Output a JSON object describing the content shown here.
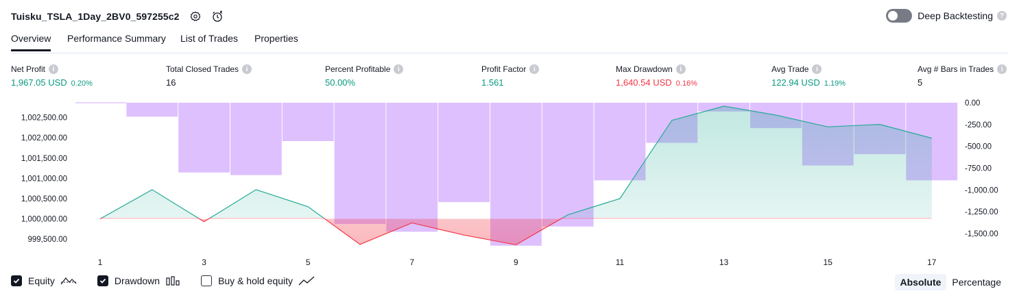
{
  "header": {
    "title": "Tuisku_TSLA_1Day_2BV0_597255c2"
  },
  "deep_backtesting": {
    "label": "Deep Backtesting",
    "enabled": false,
    "help": "?"
  },
  "tabs": [
    {
      "label": "Overview",
      "active": true
    },
    {
      "label": "Performance Summary",
      "active": false
    },
    {
      "label": "List of Trades",
      "active": false
    },
    {
      "label": "Properties",
      "active": false
    }
  ],
  "metrics": [
    {
      "label": "Net Profit",
      "value": "1,967.05 USD",
      "pct": "0.20%",
      "color": "#089981"
    },
    {
      "label": "Total Closed Trades",
      "value": "16",
      "pct": "",
      "color": "#131722"
    },
    {
      "label": "Percent Profitable",
      "value": "50.00%",
      "pct": "",
      "color": "#089981"
    },
    {
      "label": "Profit Factor",
      "value": "1.561",
      "pct": "",
      "color": "#089981"
    },
    {
      "label": "Max Drawdown",
      "value": "1,640.54 USD",
      "pct": "0.16%",
      "color": "#f23645"
    },
    {
      "label": "Avg Trade",
      "value": "122.94 USD",
      "pct": "1.19%",
      "color": "#089981"
    },
    {
      "label": "Avg # Bars in Trades",
      "value": "5",
      "pct": "",
      "color": "#131722"
    }
  ],
  "chart_data": {
    "type": "line",
    "x": [
      1,
      2,
      3,
      4,
      5,
      6,
      7,
      8,
      9,
      10,
      11,
      12,
      13,
      14,
      15,
      16,
      17
    ],
    "x_tick_labels": [
      "1",
      "3",
      "5",
      "7",
      "9",
      "11",
      "13",
      "15",
      "17"
    ],
    "left_axis": {
      "tick_labels": [
        "1,002,500.00",
        "1,002,000.00",
        "1,001,500.00",
        "1,001,000.00",
        "1,000,500.00",
        "1,000,000.00",
        "999,500.00"
      ],
      "ylim": [
        999350,
        1002780
      ]
    },
    "right_axis": {
      "tick_labels": [
        "0.00",
        "-250.00",
        "-500.00",
        "-750.00",
        "-1,000.00",
        "-1,250.00",
        "-1,500.00"
      ],
      "ylim": [
        -1650,
        0
      ]
    },
    "series": [
      {
        "name": "Equity",
        "axis": "left",
        "values": [
          1000000,
          1000720,
          999930,
          1000720,
          1000300,
          999370,
          999900,
          999600,
          999360,
          1000100,
          1000500,
          1002430,
          1002780,
          1002560,
          1002270,
          1002330,
          1001990
        ]
      },
      {
        "name": "Drawdown",
        "axis": "right",
        "values": [
          0,
          -160,
          -800,
          -830,
          -440,
          -1390,
          -1480,
          -1140,
          -1640,
          -1420,
          -890,
          -460,
          -100,
          -290,
          -720,
          -590,
          -890
        ]
      }
    ],
    "colors": {
      "equity_up": "#22ab94",
      "equity_down": "#f23645",
      "drawdown": "#d1a8ff"
    }
  },
  "legend": [
    {
      "label": "Equity",
      "checked": true,
      "icon": "equity-line-icon"
    },
    {
      "label": "Drawdown",
      "checked": true,
      "icon": "drawdown-bars-icon"
    },
    {
      "label": "Buy & hold equity",
      "checked": false,
      "icon": "buy-hold-line-icon"
    }
  ],
  "modes": [
    {
      "label": "Absolute",
      "active": true
    },
    {
      "label": "Percentage",
      "active": false
    }
  ]
}
